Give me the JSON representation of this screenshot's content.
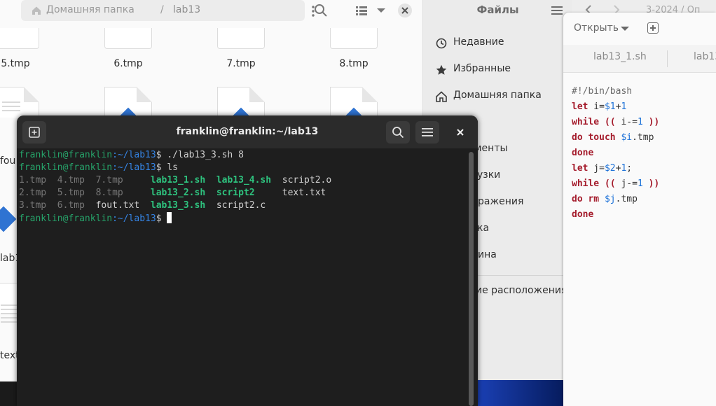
{
  "files": {
    "path_home": "Домашняя папка",
    "path_separator": "/",
    "path_current": "lab13",
    "row1": [
      "5.tmp",
      "6.tmp",
      "7.tmp",
      "8.tmp"
    ],
    "partial_labels": [
      "fou",
      "lab13_",
      "text"
    ]
  },
  "sidebar": {
    "title": "Файлы",
    "items": [
      {
        "label": "Недавние",
        "icon": "clock-icon"
      },
      {
        "label": "Избранные",
        "icon": "star-icon"
      },
      {
        "label": "Домашняя папка",
        "icon": "home-icon"
      },
      {
        "label": "о"
      },
      {
        "label": "менты"
      },
      {
        "label": "узки"
      },
      {
        "label": "ражения"
      },
      {
        "label": "ка"
      },
      {
        "label": "ина"
      },
      {
        "label": "ие расположения"
      }
    ]
  },
  "editor": {
    "title_fragment": "3-2024 / Оп",
    "open_label": "Открыть",
    "tabs": [
      "lab13_1.sh",
      "lab13"
    ],
    "code": [
      "#!/bin/bash",
      "let i=$1+1",
      "while (( i-=1 ))",
      "do touch $i.tmp",
      "done",
      "let j=$2+1;",
      "while (( j-=1 ))",
      "do rm $j.tmp",
      "done"
    ]
  },
  "terminal": {
    "title": "franklin@franklin:~/lab13",
    "prompt_user": "franklin@franklin",
    "prompt_path": ":~/lab13",
    "cmd1": "$ ./lab13_3.sh 8",
    "cmd2": "$ ls",
    "ls_rows": [
      [
        "1.tmp",
        "4.tmp",
        "7.tmp",
        "lab13_1.sh",
        "lab13_4.sh",
        "script2.o"
      ],
      [
        "2.tmp",
        "5.tmp",
        "8.tmp",
        "lab13_2.sh",
        "script2",
        "text.txt"
      ],
      [
        "3.tmp",
        "6.tmp",
        "fout.txt",
        "lab13_3.sh",
        "script2.c",
        ""
      ]
    ],
    "prompt_end": "$ "
  },
  "colors": {
    "terminal_bg": "#1e1e1e",
    "prompt_green": "#26a269",
    "path_blue": "#3584e4",
    "exec_green": "#2ec27e",
    "keyword_red": "#a51d2d"
  }
}
